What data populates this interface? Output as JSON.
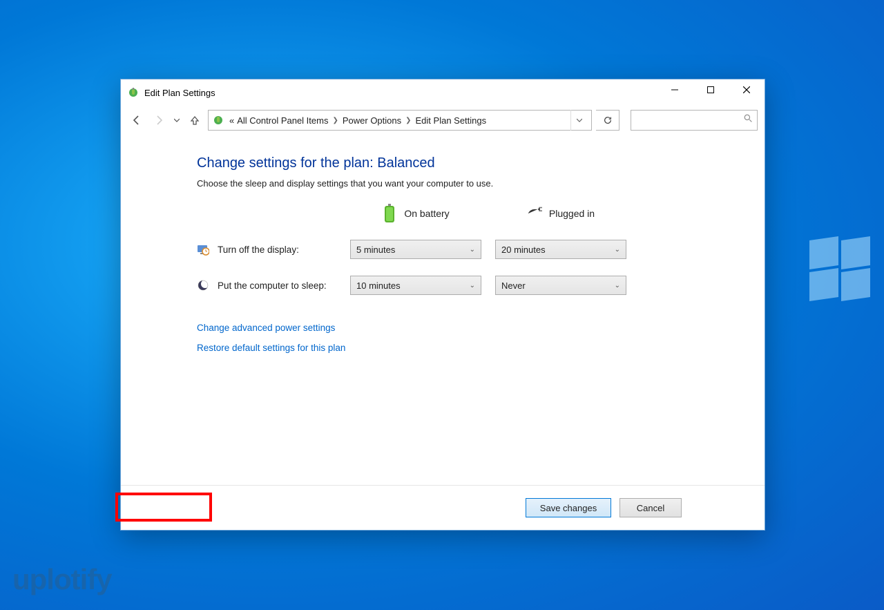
{
  "window": {
    "title": "Edit Plan Settings"
  },
  "breadcrumb": {
    "prefix": "«",
    "items": [
      "All Control Panel Items",
      "Power Options",
      "Edit Plan Settings"
    ]
  },
  "page": {
    "heading": "Change settings for the plan: Balanced",
    "subtitle": "Choose the sleep and display settings that you want your computer to use.",
    "col_battery": "On battery",
    "col_plugged": "Plugged in",
    "row_display": "Turn off the display:",
    "row_sleep": "Put the computer to sleep:",
    "display_battery": "5 minutes",
    "display_plugged": "20 minutes",
    "sleep_battery": "10 minutes",
    "sleep_plugged": "Never",
    "link_advanced": "Change advanced power settings",
    "link_restore": "Restore default settings for this plan"
  },
  "buttons": {
    "save": "Save changes",
    "cancel": "Cancel"
  },
  "watermark": "uplotify"
}
